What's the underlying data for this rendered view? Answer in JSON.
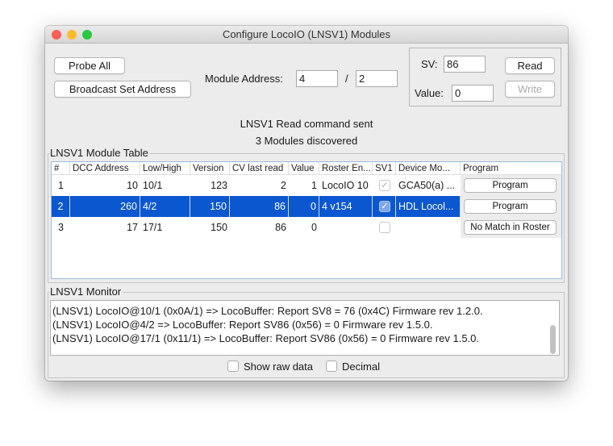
{
  "window": {
    "title": "Configure LocoIO (LNSV1) Modules"
  },
  "toolbar": {
    "probe_all": "Probe All",
    "broadcast_set_address": "Broadcast Set Address",
    "module_address_label": "Module Address:",
    "module_address_high": "4",
    "separator": "/",
    "module_address_low": "2"
  },
  "sv_panel": {
    "sv_label": "SV:",
    "sv_value": "86",
    "value_label": "Value:",
    "value_value": "0",
    "read": "Read",
    "write": "Write"
  },
  "status": {
    "line1": "LNSV1 Read command sent",
    "line2": "3 Modules discovered"
  },
  "table": {
    "title": "LNSV1 Module Table",
    "columns": [
      "#",
      "DCC Address",
      "Low/High",
      "Version",
      "CV last read",
      "Value",
      "Roster En...",
      "SV1",
      "Device Mo...",
      "Program"
    ],
    "rows": [
      {
        "num": "1",
        "dcc": "10",
        "lowhigh": "10/1",
        "version": "123",
        "cv": "2",
        "value": "1",
        "roster": "LocoIO 10",
        "sv1": true,
        "device": "GCA50(a) ...",
        "program": "Program",
        "selected": false
      },
      {
        "num": "2",
        "dcc": "260",
        "lowhigh": "4/2",
        "version": "150",
        "cv": "86",
        "value": "0",
        "roster": "4 v154",
        "sv1": true,
        "device": "HDL Locol...",
        "program": "Program",
        "selected": true
      },
      {
        "num": "3",
        "dcc": "17",
        "lowhigh": "17/1",
        "version": "150",
        "cv": "86",
        "value": "0",
        "roster": "",
        "sv1": false,
        "device": "",
        "program": "No Match in Roster",
        "selected": false
      }
    ]
  },
  "monitor": {
    "title": "LNSV1 Monitor",
    "lines": [
      "(LNSV1) LocoIO@10/1 (0x0A/1) => LocoBuffer: Report SV8 = 76 (0x4C) Firmware rev 1.2.0.",
      "(LNSV1) LocoIO@4/2 => LocoBuffer: Report SV86 (0x56) = 0 Firmware rev 1.5.0.",
      "(LNSV1) LocoIO@17/1 (0x11/1) => LocoBuffer: Report SV86 (0x56) = 0 Firmware rev 1.5.0."
    ],
    "show_raw_data": "Show raw data",
    "decimal": "Decimal"
  },
  "colors": {
    "selection": "#0b57d0",
    "close": "#fc5f57",
    "minimize": "#fdbc2e",
    "zoom": "#28c840"
  }
}
